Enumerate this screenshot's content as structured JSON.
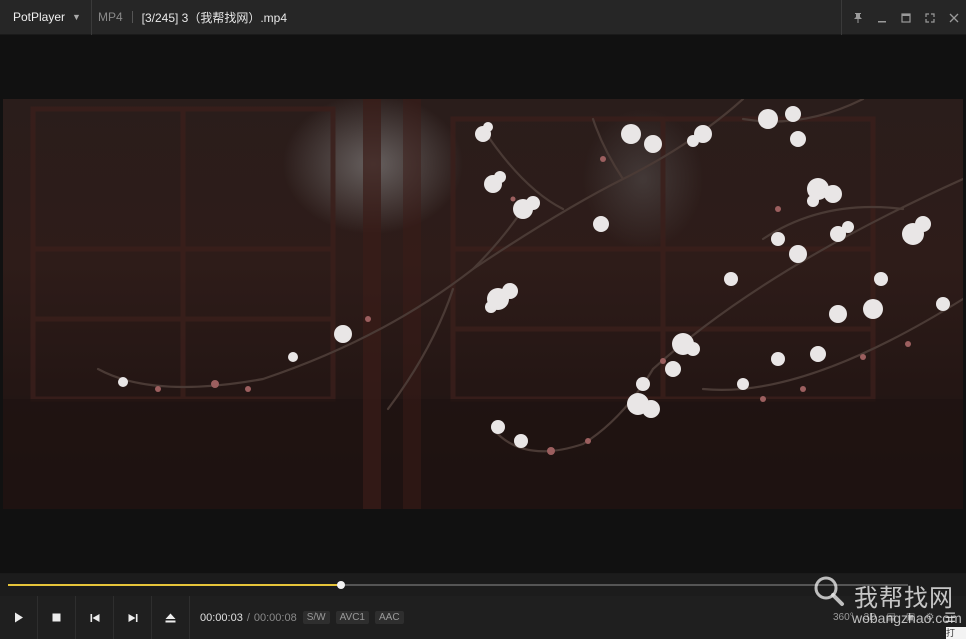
{
  "titlebar": {
    "app_name": "PotPlayer",
    "format": "MP4",
    "file_title": "[3/245] 3（我帮找网）.mp4"
  },
  "playback": {
    "current_time": "00:00:03",
    "separator": "/",
    "duration": "00:00:08",
    "progress_fraction": 0.37,
    "badges": [
      "S/W",
      "AVC1",
      "AAC"
    ]
  },
  "right_controls": {
    "vr_label": "360°",
    "three_d_label": "3D"
  },
  "watermark": {
    "chinese": "我帮找网",
    "url": "wobangzhao.com"
  },
  "tooltip": {
    "text": "打"
  },
  "colors": {
    "accent_progress": "#e6c43a",
    "titlebar_bg": "#262626",
    "video_bg": "#111111"
  }
}
